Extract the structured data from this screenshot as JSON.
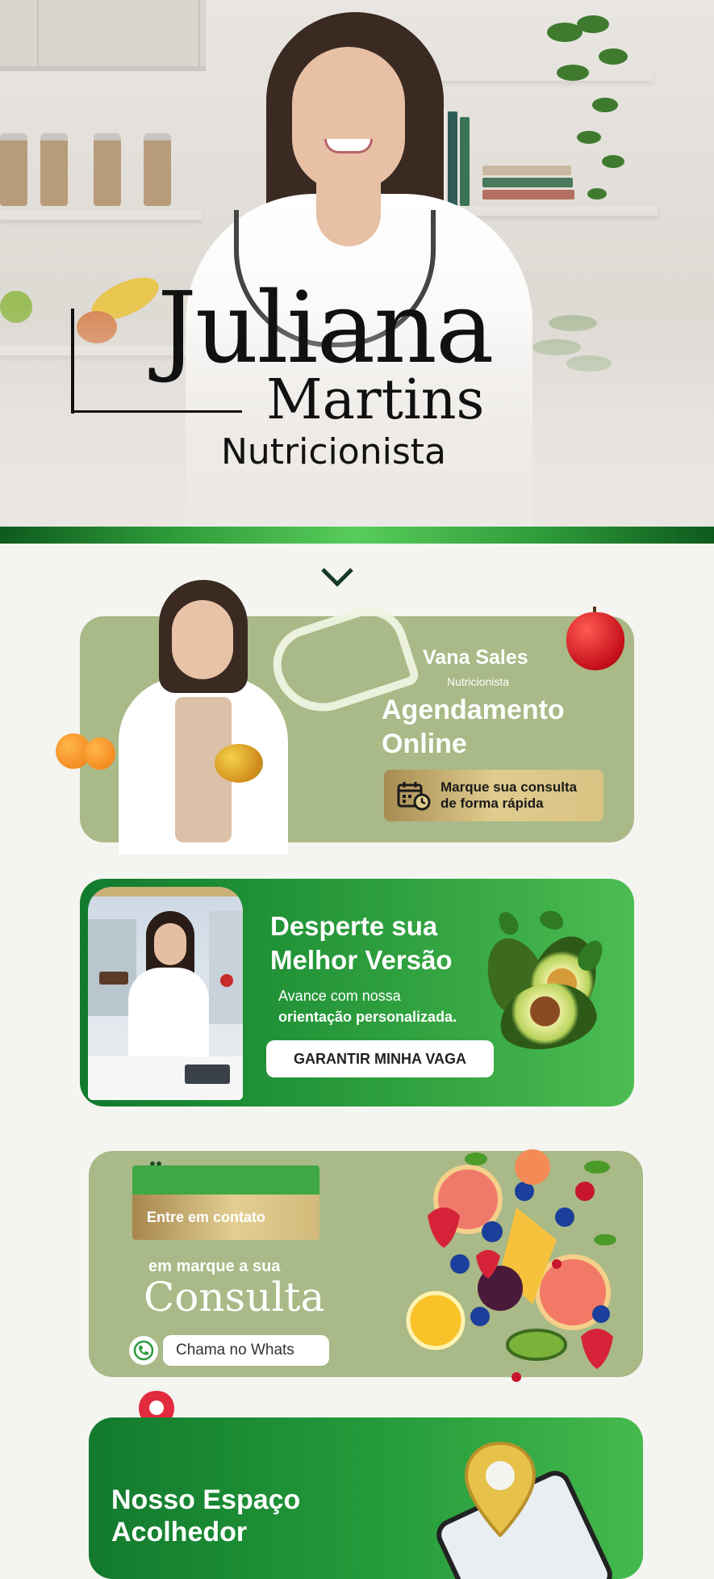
{
  "hero": {
    "first_name": "Juliana",
    "last_name": "Martins",
    "profession": "Nutricionista"
  },
  "chevron": "chevron-down-icon",
  "card_booking": {
    "name": "Vana Sales",
    "role": "Nutricionista",
    "headline_line1": "Agendamento",
    "headline_line2": "Online",
    "button_line1": "Marque sua consulta",
    "button_line2": "de forma rápida",
    "button_icon": "calendar-clock-icon"
  },
  "card_offer": {
    "headline_line1": "Desperte sua",
    "headline_line2": "Melhor Versão",
    "sub_line1": "Avance com nossa",
    "sub_line2": "orientação personalizada.",
    "button": "GARANTIR MINHA VAGA"
  },
  "card_contact": {
    "tab_label": "Entre em contato",
    "line1": "em marque a sua",
    "script": "Consulta",
    "whats_label": "Chama no Whats",
    "whats_icon": "whatsapp-icon"
  },
  "card_location": {
    "headline_line1": "Nosso Espaço",
    "headline_line2": "Acolhedor"
  },
  "colors": {
    "olive_card": "#a9b987",
    "dark_green": "#137a2e",
    "light_green": "#4cbd52",
    "gold": "#e0cc8e"
  }
}
